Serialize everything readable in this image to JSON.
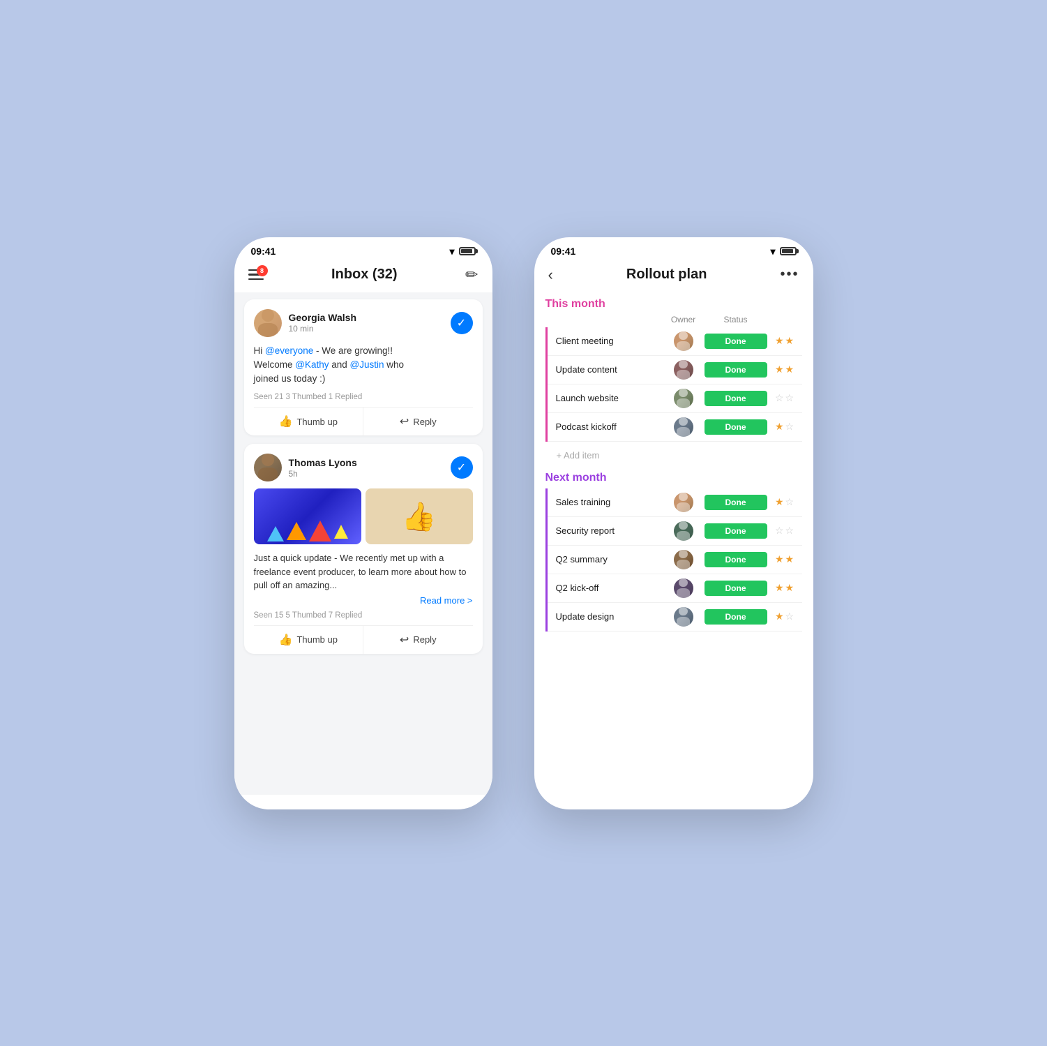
{
  "background_color": "#b8c8e8",
  "left_phone": {
    "status_time": "09:41",
    "header": {
      "title": "Inbox (32)",
      "notification_count": "8"
    },
    "messages": [
      {
        "id": "msg1",
        "author": "Georgia Walsh",
        "time": "10 min",
        "body_parts": [
          {
            "text": "Hi ",
            "type": "normal"
          },
          {
            "text": "@everyone",
            "type": "mention"
          },
          {
            "text": " - We are growing!!\nWelcome ",
            "type": "normal"
          },
          {
            "text": "@Kathy",
            "type": "mention"
          },
          {
            "text": " and ",
            "type": "normal"
          },
          {
            "text": "@Justin",
            "type": "mention"
          },
          {
            "text": " who\njoined us today :)",
            "type": "normal"
          }
        ],
        "stats": "Seen 21   3 Thumbed   1 Replied",
        "thumb_up_label": "Thumb up",
        "reply_label": "Reply",
        "avatar_class": "av-georgia"
      },
      {
        "id": "msg2",
        "author": "Thomas Lyons",
        "time": "5h",
        "has_images": true,
        "body": "Just a quick update - We recently met up with a freelance event producer, to learn more about how to pull off an amazing...",
        "read_more": "Read more >",
        "stats": "Seen 15   5 Thumbed   7 Replied",
        "thumb_up_label": "Thumb up",
        "reply_label": "Reply",
        "avatar_class": "av-thomas"
      }
    ]
  },
  "right_phone": {
    "status_time": "09:41",
    "header": {
      "title": "Rollout plan",
      "back_label": "‹",
      "more_label": "•••"
    },
    "sections": [
      {
        "id": "this_month",
        "label": "This month",
        "color": "pink",
        "column_owner": "Owner",
        "column_status": "Status",
        "tasks": [
          {
            "name": "Client meeting",
            "status": "Done",
            "rating": 2,
            "avatar_class": "av-1"
          },
          {
            "name": "Update content",
            "status": "Done",
            "rating": 2,
            "avatar_class": "av-2"
          },
          {
            "name": "Launch website",
            "status": "Done",
            "rating": 0,
            "avatar_class": "av-3"
          },
          {
            "name": "Podcast kickoff",
            "status": "Done",
            "rating": 1,
            "avatar_class": "av-4"
          }
        ],
        "add_item_label": "+ Add item"
      },
      {
        "id": "next_month",
        "label": "Next month",
        "color": "purple",
        "tasks": [
          {
            "name": "Sales training",
            "status": "Done",
            "rating": 1,
            "avatar_class": "av-1"
          },
          {
            "name": "Security report",
            "status": "Done",
            "rating": 0,
            "avatar_class": "av-5"
          },
          {
            "name": "Q2 summary",
            "status": "Done",
            "rating": 2,
            "avatar_class": "av-6"
          },
          {
            "name": "Q2 kick-off",
            "status": "Done",
            "rating": 2,
            "avatar_class": "av-7"
          },
          {
            "name": "Update design",
            "status": "Done",
            "rating": 1,
            "avatar_class": "av-4"
          }
        ]
      }
    ]
  }
}
